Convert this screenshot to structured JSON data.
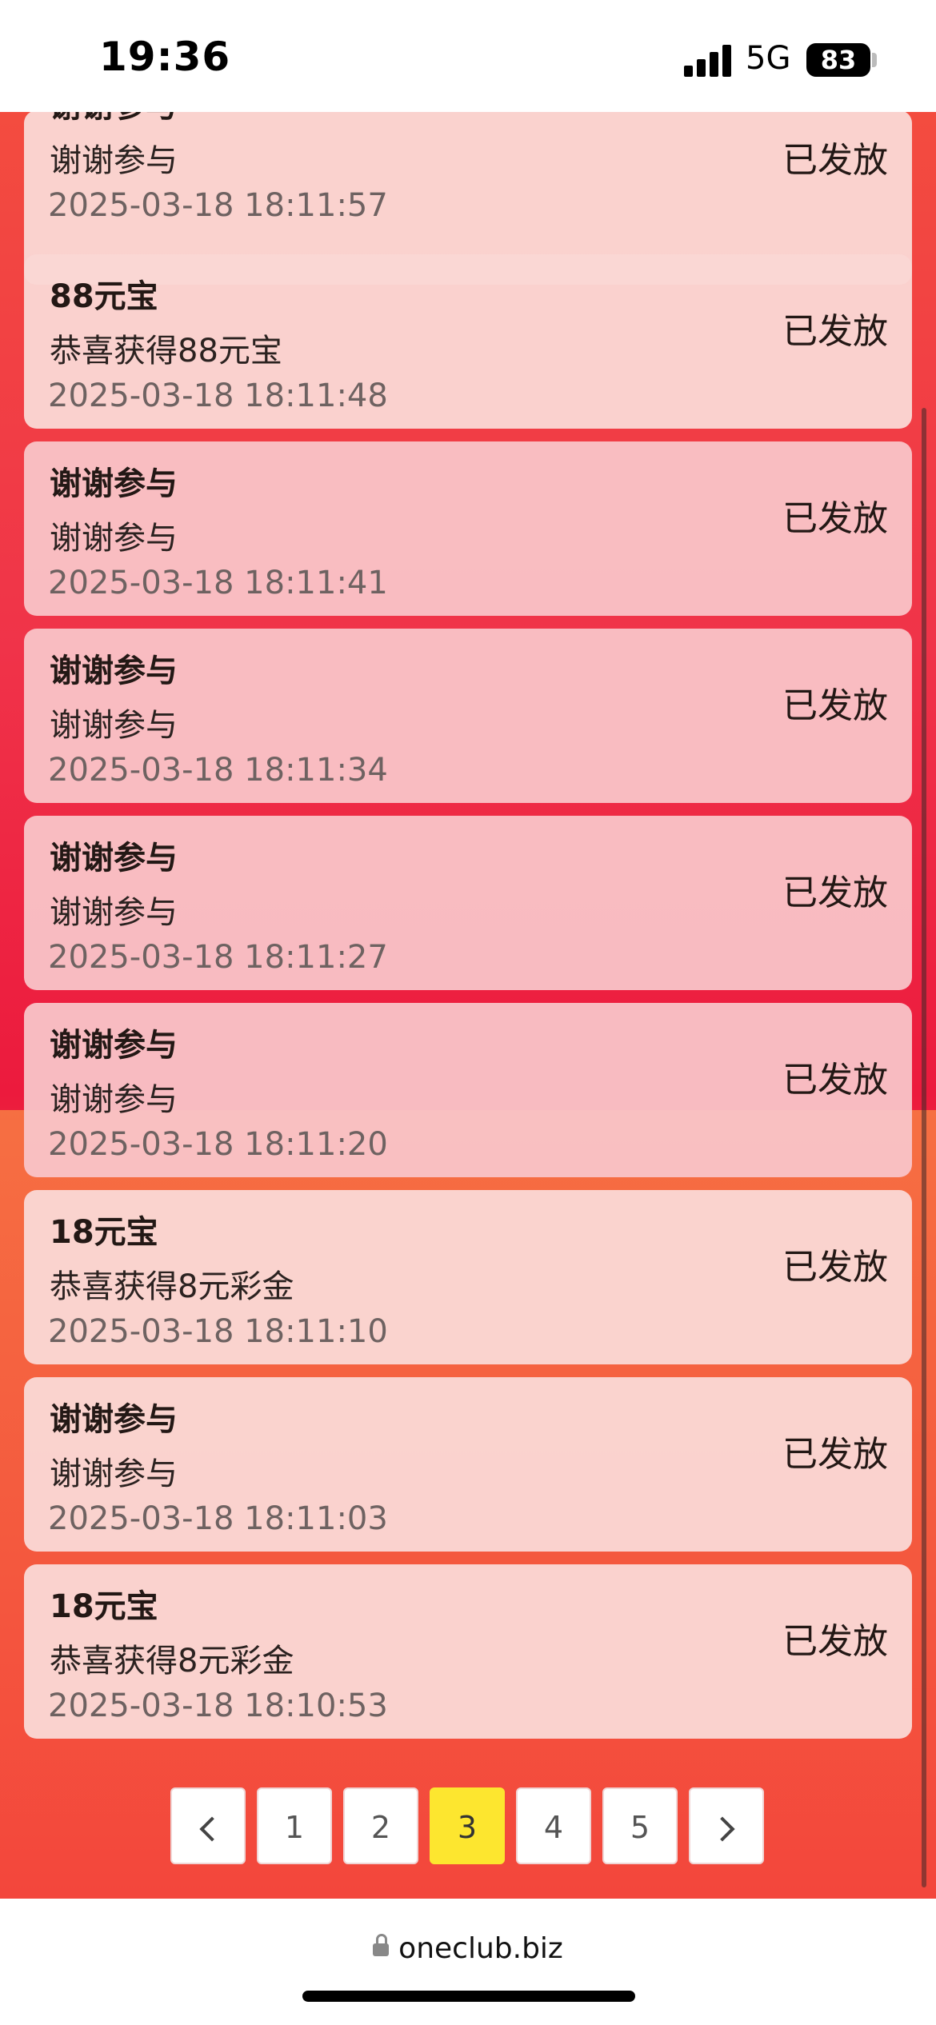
{
  "status_bar": {
    "time": "19:36",
    "network": "5G",
    "battery": "83"
  },
  "records": [
    {
      "title": "谢谢参与",
      "desc": "谢谢参与",
      "time": "2025-03-18 18:11:57",
      "status": "已发放"
    },
    {
      "title": "88元宝",
      "desc": "恭喜获得88元宝",
      "time": "2025-03-18 18:11:48",
      "status": "已发放"
    },
    {
      "title": "谢谢参与",
      "desc": "谢谢参与",
      "time": "2025-03-18 18:11:41",
      "status": "已发放"
    },
    {
      "title": "谢谢参与",
      "desc": "谢谢参与",
      "time": "2025-03-18 18:11:34",
      "status": "已发放"
    },
    {
      "title": "谢谢参与",
      "desc": "谢谢参与",
      "time": "2025-03-18 18:11:27",
      "status": "已发放"
    },
    {
      "title": "谢谢参与",
      "desc": "谢谢参与",
      "time": "2025-03-18 18:11:20",
      "status": "已发放"
    },
    {
      "title": "18元宝",
      "desc": "恭喜获得8元彩金",
      "time": "2025-03-18 18:11:10",
      "status": "已发放"
    },
    {
      "title": "谢谢参与",
      "desc": "谢谢参与",
      "time": "2025-03-18 18:11:03",
      "status": "已发放"
    },
    {
      "title": "18元宝",
      "desc": "恭喜获得8元彩金",
      "time": "2025-03-18 18:10:53",
      "status": "已发放"
    }
  ],
  "pagination": {
    "pages": [
      "1",
      "2",
      "3",
      "4",
      "5"
    ],
    "current": "3",
    "prev_icon": "chevron-left-icon",
    "next_icon": "chevron-right-icon"
  },
  "browser": {
    "url": "oneclub.biz"
  }
}
